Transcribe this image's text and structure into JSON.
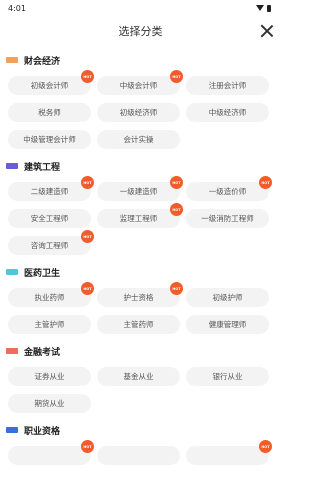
{
  "statusbar": {
    "time": "4:01"
  },
  "header": {
    "title": "选择分类"
  },
  "colors": {
    "accent": "#f25b2b",
    "chip_bg": "#f3f3f3",
    "section_icons": [
      "#f3a05b",
      "#6a5bd6",
      "#52c7d6",
      "#ef6b5b",
      "#3b6fd8"
    ]
  },
  "sections": [
    {
      "title": "财会经济",
      "items": [
        {
          "label": "初级会计师",
          "hot": true
        },
        {
          "label": "中级会计师",
          "hot": true
        },
        {
          "label": "注册会计师",
          "hot": false
        },
        {
          "label": "税务师",
          "hot": false
        },
        {
          "label": "初级经济师",
          "hot": false
        },
        {
          "label": "中级经济师",
          "hot": false
        },
        {
          "label": "中级管理会计师",
          "hot": false
        },
        {
          "label": "会计实操",
          "hot": false
        }
      ]
    },
    {
      "title": "建筑工程",
      "items": [
        {
          "label": "二级建造师",
          "hot": true
        },
        {
          "label": "一级建造师",
          "hot": true
        },
        {
          "label": "一级造价师",
          "hot": true
        },
        {
          "label": "安全工程师",
          "hot": false
        },
        {
          "label": "监理工程师",
          "hot": true
        },
        {
          "label": "一级消防工程师",
          "hot": false
        },
        {
          "label": "咨询工程师",
          "hot": true
        }
      ]
    },
    {
      "title": "医药卫生",
      "items": [
        {
          "label": "执业药师",
          "hot": true
        },
        {
          "label": "护士资格",
          "hot": true
        },
        {
          "label": "初级护师",
          "hot": false
        },
        {
          "label": "主管护师",
          "hot": false
        },
        {
          "label": "主管药师",
          "hot": false
        },
        {
          "label": "健康管理师",
          "hot": false
        }
      ]
    },
    {
      "title": "金融考试",
      "items": [
        {
          "label": "证券从业",
          "hot": false
        },
        {
          "label": "基金从业",
          "hot": false
        },
        {
          "label": "银行从业",
          "hot": false
        },
        {
          "label": "期货从业",
          "hot": false
        }
      ]
    },
    {
      "title": "职业资格",
      "items": [
        {
          "label": "",
          "hot": true
        },
        {
          "label": "",
          "hot": false
        },
        {
          "label": "",
          "hot": true
        }
      ]
    }
  ],
  "hot_badge_text": "HOT"
}
